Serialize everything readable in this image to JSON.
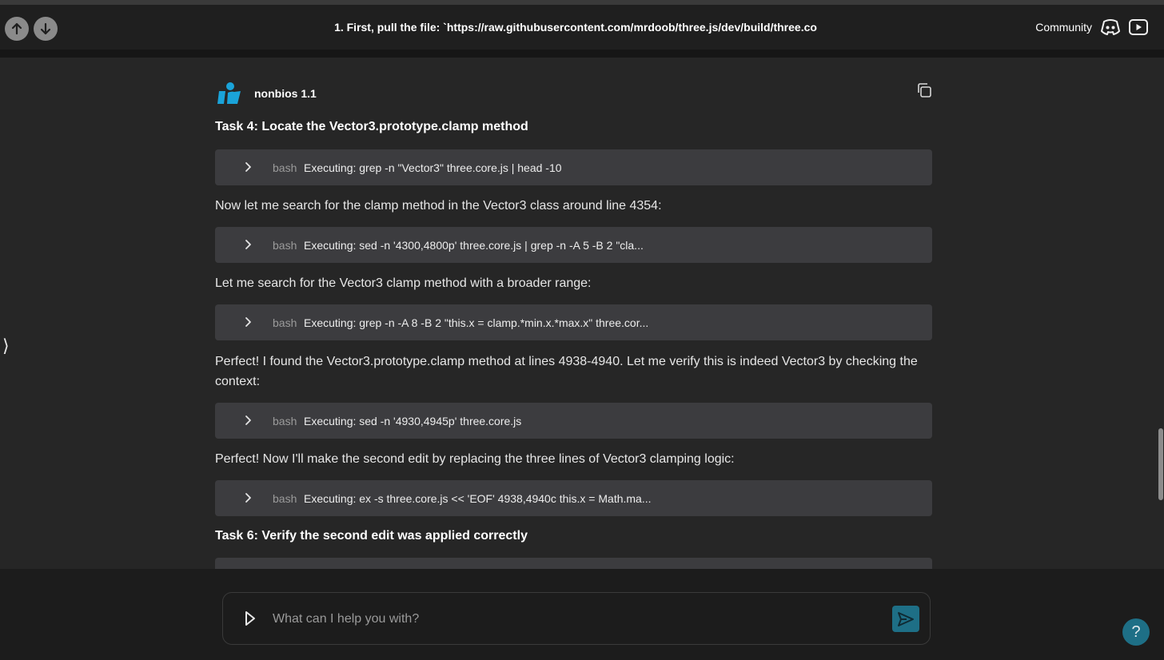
{
  "header": {
    "title": "1. First, pull the file: `https://raw.githubusercontent.com/mrdoob/three.js/dev/build/three.co",
    "community_label": "Community"
  },
  "message": {
    "model_name": "nonbios 1.1",
    "blocks": [
      {
        "type": "task",
        "text": "Task 4: Locate the Vector3.prototype.clamp method"
      },
      {
        "type": "tool",
        "lang": "bash",
        "cmd": "Executing: grep -n \"Vector3\" three.core.js | head -10"
      },
      {
        "type": "para",
        "text": "Now let me search for the clamp method in the Vector3 class around line 4354:"
      },
      {
        "type": "tool",
        "lang": "bash",
        "cmd": "Executing: sed -n '4300,4800p' three.core.js | grep -n -A 5 -B 2 \"cla..."
      },
      {
        "type": "para",
        "text": "Let me search for the Vector3 clamp method with a broader range:"
      },
      {
        "type": "tool",
        "lang": "bash",
        "cmd": "Executing: grep -n -A 8 -B 2 \"this.x = clamp.*min.x.*max.x\" three.cor..."
      },
      {
        "type": "para",
        "text": "Perfect! I found the Vector3.prototype.clamp method at lines 4938-4940. Let me verify this is indeed Vector3 by checking the context:"
      },
      {
        "type": "tool",
        "lang": "bash",
        "cmd": "Executing: sed -n '4930,4945p' three.core.js"
      },
      {
        "type": "para",
        "text": "Perfect! Now I'll make the second edit by replacing the three lines of Vector3 clamping logic:"
      },
      {
        "type": "tool",
        "lang": "bash",
        "cmd": "Executing: ex -s three.core.js << 'EOF' 4938,4940c this.x = Math.ma..."
      },
      {
        "type": "task",
        "text": "Task 6: Verify the second edit was applied correctly"
      }
    ]
  },
  "composer": {
    "placeholder": "What can I help you with?"
  },
  "help_label": "?",
  "sidebar_toggle": "⟩",
  "colors": {
    "accent": "#1e6f86",
    "logo": "#1aa3d9",
    "tool_bg": "#3c3c3f"
  }
}
